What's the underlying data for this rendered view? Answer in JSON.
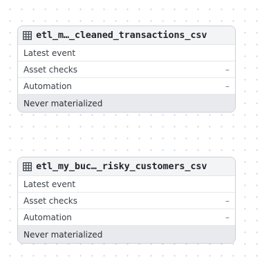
{
  "assets": [
    {
      "title": "etl_m…_cleaned_transactions_csv",
      "rows": [
        {
          "label": "Latest event",
          "value": ""
        },
        {
          "label": "Asset checks",
          "value": "–"
        },
        {
          "label": "Automation",
          "value": "–"
        }
      ],
      "status": "Never materialized"
    },
    {
      "title": "etl_my_buc…_risky_customers_csv",
      "rows": [
        {
          "label": "Latest event",
          "value": ""
        },
        {
          "label": "Asset checks",
          "value": "–"
        },
        {
          "label": "Automation",
          "value": "–"
        }
      ],
      "status": "Never materialized"
    }
  ],
  "icons": {
    "asset": "table-icon"
  }
}
